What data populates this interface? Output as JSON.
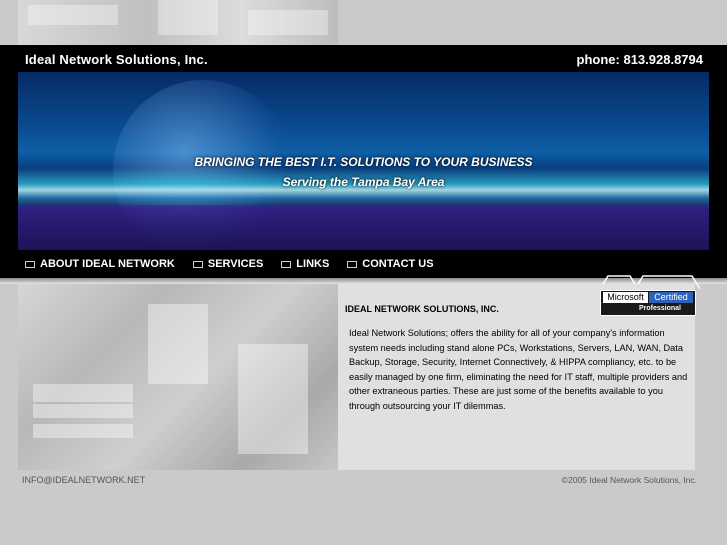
{
  "header": {
    "company": "Ideal Network Solutions, Inc.",
    "phone": "phone: 813.928.8794"
  },
  "banner": {
    "tagline": "BRINGING THE BEST I.T. SOLUTIONS TO YOUR BUSINESS",
    "subtagline": "Serving the Tampa Bay Area"
  },
  "nav": [
    {
      "label": "ABOUT IDEAL NETWORK"
    },
    {
      "label": "SERVICES"
    },
    {
      "label": "LINKS"
    },
    {
      "label": "CONTACT US"
    }
  ],
  "badge": {
    "brand": "Microsoft",
    "certified": "Certified",
    "level": "Professional"
  },
  "content": {
    "title": "IDEAL NETWORK SOLUTIONS, INC.",
    "body": "Ideal Network Solutions; offers the ability for all of your company's information system needs including stand alone PCs, Workstations, Servers, LAN, WAN, Data Backup, Storage, Security, Internet Connectively, & HIPPA compliancy, etc. to be easily managed by one firm, eliminating the need for IT staff, multiple providers and other extraneous parties. These are just some of the benefits available to you through outsourcing your IT dilemmas."
  },
  "footer": {
    "email": "INFO@IDEALNETWORK.NET",
    "copyright": "©2005 Ideal Network Solutions, Inc."
  },
  "colors": {
    "background": "#cacaca",
    "header": "#000000",
    "accent": "#2d62b8"
  }
}
